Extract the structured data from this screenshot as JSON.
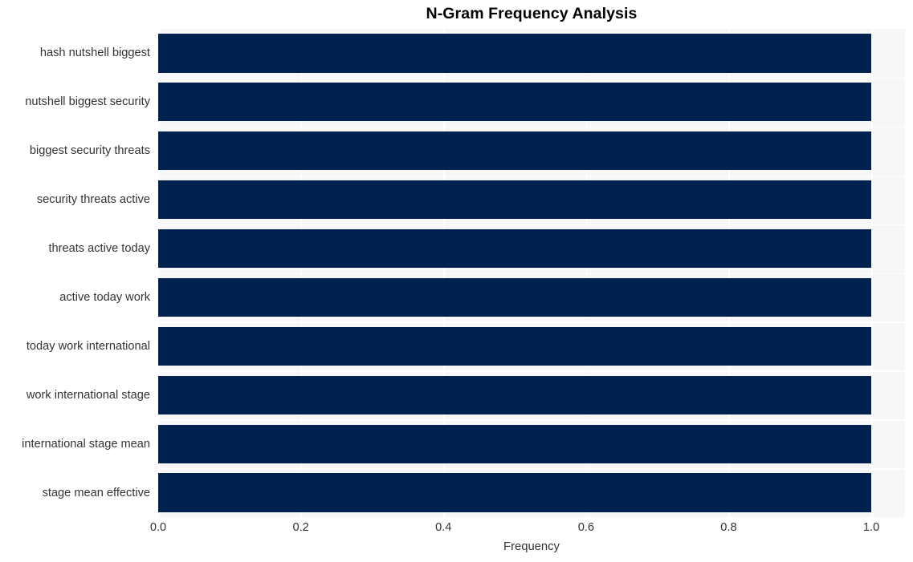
{
  "chart_data": {
    "type": "bar",
    "orientation": "horizontal",
    "title": "N-Gram Frequency Analysis",
    "xlabel": "Frequency",
    "ylabel": "",
    "categories": [
      "hash nutshell biggest",
      "nutshell biggest security",
      "biggest security threats",
      "security threats active",
      "threats active today",
      "active today work",
      "today work international",
      "work international stage",
      "international stage mean",
      "stage mean effective"
    ],
    "values": [
      1.0,
      1.0,
      1.0,
      1.0,
      1.0,
      1.0,
      1.0,
      1.0,
      1.0,
      1.0
    ],
    "xlim": [
      0.0,
      1.0472
    ],
    "xticks": [
      0.0,
      0.2,
      0.4,
      0.6,
      0.8,
      1.0
    ],
    "xticklabels": [
      "0.0",
      "0.2",
      "0.4",
      "0.6",
      "0.8",
      "1.0"
    ],
    "grid": true,
    "grid_color": "#ffffff",
    "plot_background": "#f7f7f7",
    "bar_color": "#012250",
    "legend": null
  }
}
